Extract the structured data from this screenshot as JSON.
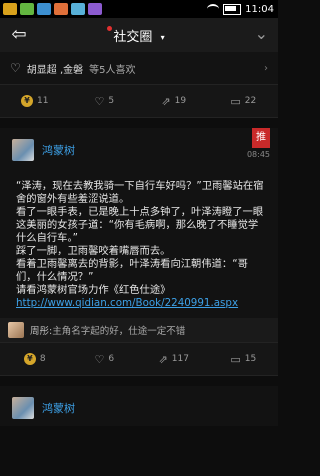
{
  "status": {
    "time": "11:04"
  },
  "header": {
    "title": "社交圈",
    "caret": "▾",
    "back_glyph": "⇦",
    "more_glyph": "⌄"
  },
  "likes": {
    "heart": "♡",
    "names": "胡显超 ,金磐",
    "count_text": "等5人喜欢",
    "chevron": "›"
  },
  "actions1": {
    "coin": "11",
    "likes": "5",
    "shares": "19",
    "comments": "22"
  },
  "post": {
    "user": "鸿蒙树",
    "tag": "推",
    "time": "08:45",
    "lines": [
      "“泽涛，现在去教我骑一下自行车好吗？”卫雨馨站在宿舍的窗外有些羞涩说道。",
      "看了一眼手表，已是晚上十点多钟了，叶泽涛瞪了一眼这美丽的女孩子道：“你有毛病啊，那么晚了不睡觉学什么自行车。”",
      "踩了一脚，卫雨馨咬着嘴唇而去。",
      "看着卫雨馨离去的背影，叶泽涛看向江朝伟道：“哥们，什么情况？”",
      "请看鸿蒙树官场力作《红色仕途》"
    ],
    "link": "http://www.qidian.com/Book/2240991.aspx"
  },
  "comment": {
    "name": "周彤:",
    "text": " 主角名字起的好，仕途一定不错"
  },
  "actions2": {
    "coin": "8",
    "likes": "6",
    "shares": "117",
    "comments": "15"
  },
  "post2": {
    "user": "鸿蒙树"
  },
  "icons": {
    "coin": "coin-icon",
    "like": "heart-icon",
    "share": "share-icon",
    "comment": "comment-icon"
  }
}
